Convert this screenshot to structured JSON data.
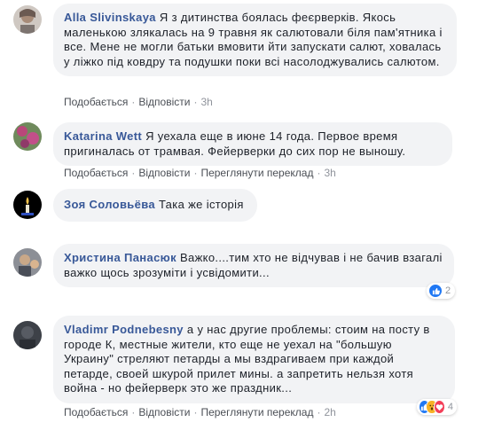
{
  "comments": [
    {
      "author": "Alla Slivinskaya",
      "text": "Я з дитинства боялась феєрверків. Якось маленькою злякалась на 9 травня як салютовали біля пам'ятника і все. Мене не могли батьки вмовити йти запускати салют, ховалась у ліжко під ковдру та подушки поки всі насолоджувались салютом.",
      "like": "Подобається",
      "reply": "Відповісти",
      "time": "3h"
    },
    {
      "author": "Katarina Wett",
      "text": "Я уехала еще в июне 14 года. Первое время пригиналась от трамвая. Фейерверки до сих пор не выношу.",
      "like": "Подобається",
      "reply": "Відповісти",
      "translate": "Переглянути переклад",
      "time": "3h"
    },
    {
      "author": "Зоя Соловьёва",
      "text": "Така же історія"
    },
    {
      "author": "Христина Панасюк",
      "text": "Важко....тим хто не відчував і не бачив взагалі важко щось зрозуміти і усвідомити...",
      "reaction_count": "2"
    },
    {
      "author": "Vladimr Podnebesny",
      "text": "а у нас другие проблемы: стоим на посту в городе К, местные жители, кто еще не уехал на \"большую Украину\" стреляют петарды а мы вздрагиваем при каждой петарде, своей шкурой прилет мины. а запретить нельзя хотя война - но фейерверк это же праздник...",
      "like": "Подобається",
      "reply": "Відповісти",
      "translate": "Переглянути переклад",
      "time": "2h",
      "reaction_count": "4"
    }
  ],
  "colors": {
    "author": "#385898",
    "bubble": "#f2f3f5",
    "like": "#2078f4",
    "love": "#f33e58",
    "wow": "#f7b125"
  }
}
